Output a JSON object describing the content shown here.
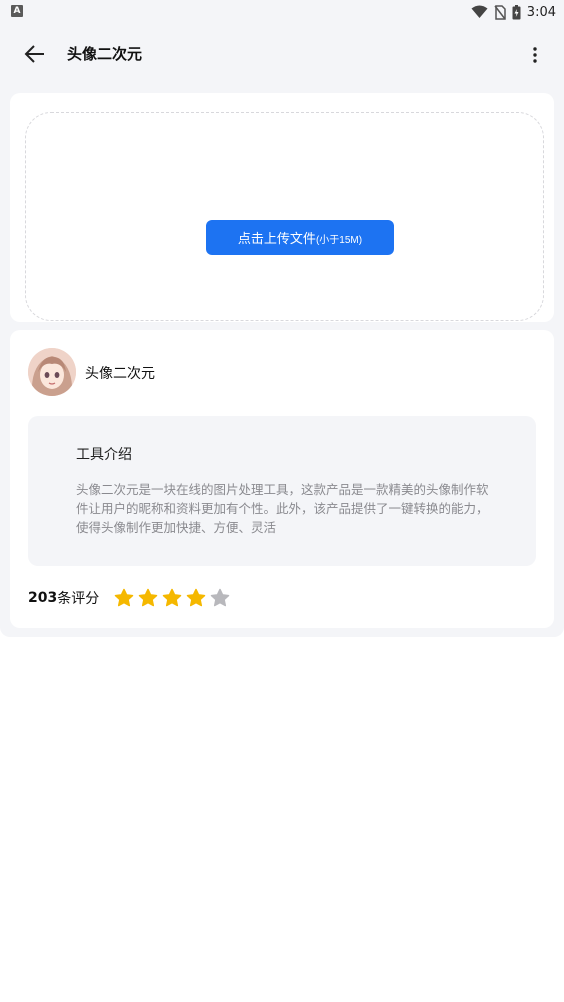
{
  "status_bar": {
    "time": "3:04",
    "app_icon_letter": "A"
  },
  "app_bar": {
    "title": "头像二次元",
    "back_icon": "arrow-left-icon",
    "menu_icon": "more-vertical-icon"
  },
  "upload": {
    "button_label": "点击上传文件",
    "size_hint": "(小于15M)"
  },
  "tool": {
    "name": "头像二次元",
    "intro_title": "工具介绍",
    "intro_text": "头像二次元是一块在线的图片处理工具，这款产品是一款精美的头像制作软件让用户的昵称和资料更加有个性。此外，该产品提供了一键转换的能力，使得头像制作更加快捷、方便、灵活"
  },
  "rating": {
    "count": "203",
    "label": "条评分",
    "stars_filled": 4,
    "stars_total": 5
  },
  "colors": {
    "accent": "#1d73f2",
    "star_filled": "#f5b800",
    "star_empty": "#b8b8bc"
  }
}
